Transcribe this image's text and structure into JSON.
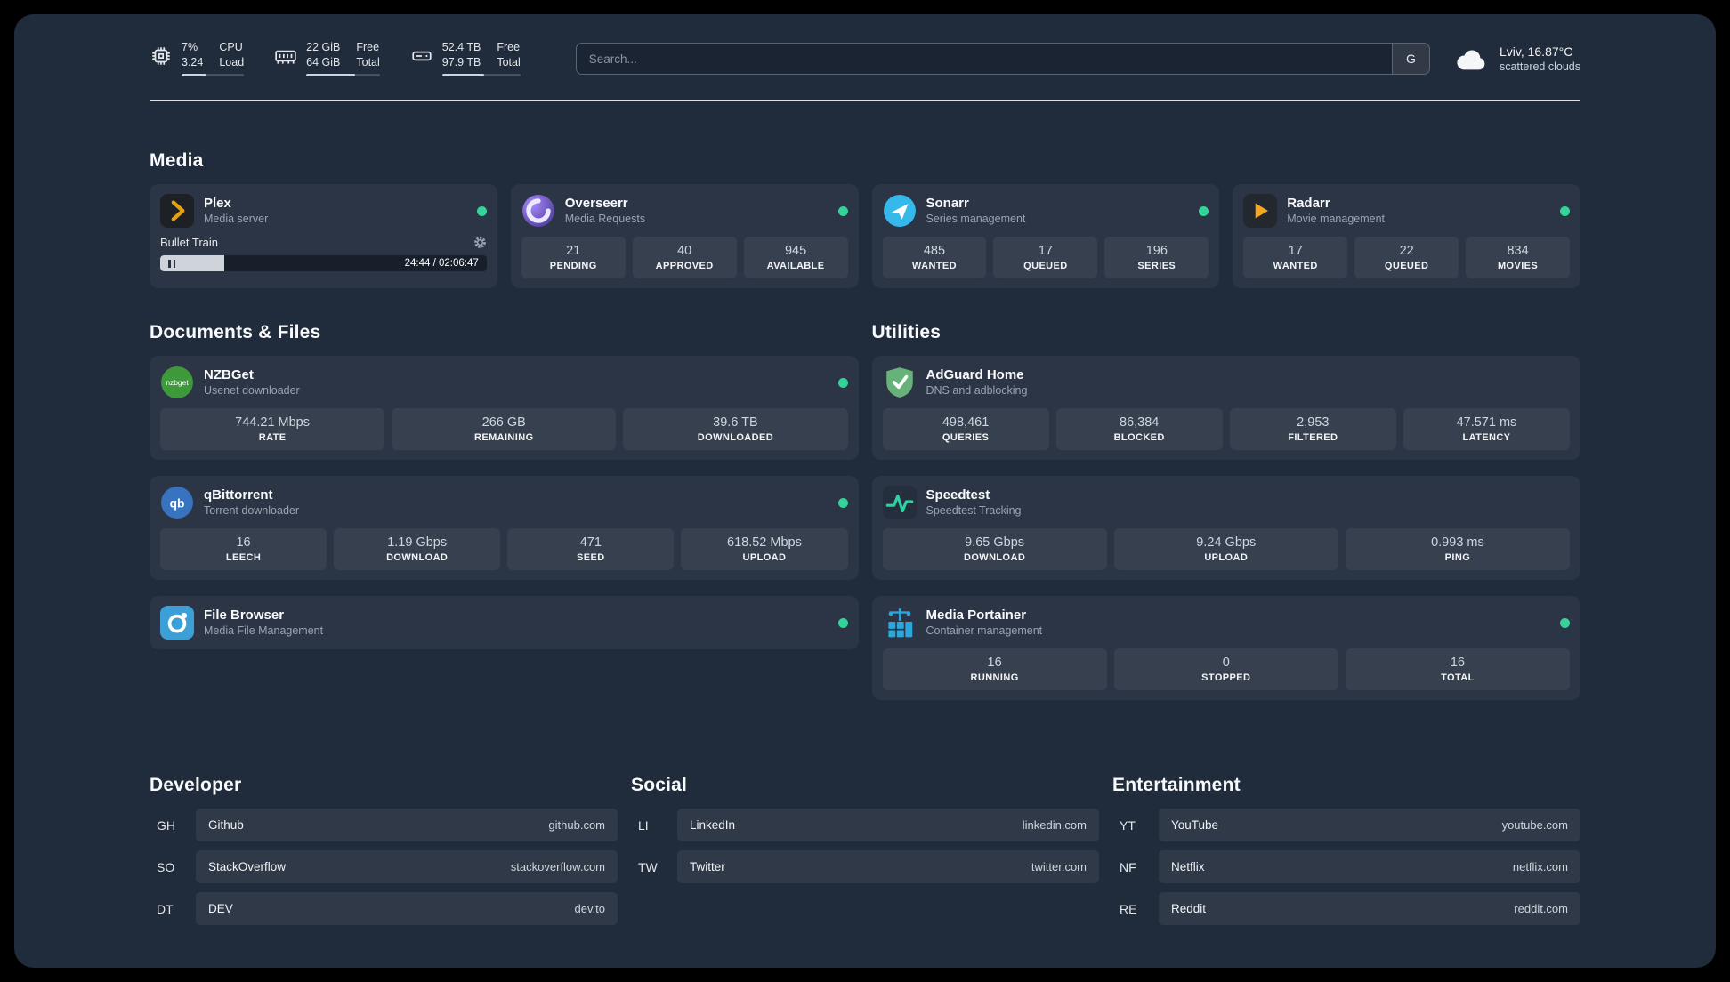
{
  "colors": {
    "background": "#202b3b",
    "online_dot": "#34d399",
    "plex_amber": "#e5a00d",
    "accent_blue": "#29a8e0"
  },
  "topbar": {
    "cpu": {
      "value_top": "7%",
      "value_bottom": "3.24",
      "label_top": "CPU",
      "label_bottom": "Load",
      "bar_pct": 40
    },
    "memory": {
      "value_top": "22 GiB",
      "value_bottom": "64 GiB",
      "label_top": "Free",
      "label_bottom": "Total",
      "bar_pct": 66
    },
    "disk": {
      "value_top": "52.4 TB",
      "value_bottom": "97.9 TB",
      "label_top": "Free",
      "label_bottom": "Total",
      "bar_pct": 54
    },
    "search": {
      "placeholder": "Search...",
      "button": "G"
    },
    "weather": {
      "location": "Lviv, 16.87°C",
      "condition": "scattered clouds"
    }
  },
  "media": {
    "heading": "Media",
    "cards": [
      {
        "title": "Plex",
        "subtitle": "Media server",
        "online": true,
        "player": {
          "track": "Bullet Train",
          "time": "24:44 / 02:06:47",
          "progress_pct": 19.5
        }
      },
      {
        "title": "Overseerr",
        "subtitle": "Media Requests",
        "online": true,
        "stats": [
          {
            "value": "21",
            "label": "PENDING"
          },
          {
            "value": "40",
            "label": "APPROVED"
          },
          {
            "value": "945",
            "label": "AVAILABLE"
          }
        ]
      },
      {
        "title": "Sonarr",
        "subtitle": "Series management",
        "online": true,
        "stats": [
          {
            "value": "485",
            "label": "WANTED"
          },
          {
            "value": "17",
            "label": "QUEUED"
          },
          {
            "value": "196",
            "label": "SERIES"
          }
        ]
      },
      {
        "title": "Radarr",
        "subtitle": "Movie management",
        "online": true,
        "stats": [
          {
            "value": "17",
            "label": "WANTED"
          },
          {
            "value": "22",
            "label": "QUEUED"
          },
          {
            "value": "834",
            "label": "MOVIES"
          }
        ]
      }
    ]
  },
  "documents": {
    "heading": "Documents & Files",
    "cards": [
      {
        "title": "NZBGet",
        "subtitle": "Usenet downloader",
        "online": true,
        "icon_text": "nzbget",
        "stats": [
          {
            "value": "744.21 Mbps",
            "label": "RATE"
          },
          {
            "value": "266 GB",
            "label": "REMAINING"
          },
          {
            "value": "39.6 TB",
            "label": "DOWNLOADED"
          }
        ]
      },
      {
        "title": "qBittorrent",
        "subtitle": "Torrent downloader",
        "online": true,
        "icon_text": "qb",
        "stats": [
          {
            "value": "16",
            "label": "LEECH"
          },
          {
            "value": "1.19 Gbps",
            "label": "DOWNLOAD"
          },
          {
            "value": "471",
            "label": "SEED"
          },
          {
            "value": "618.52 Mbps",
            "label": "UPLOAD"
          }
        ]
      },
      {
        "title": "File Browser",
        "subtitle": "Media File Management",
        "online": true
      }
    ]
  },
  "utilities": {
    "heading": "Utilities",
    "cards": [
      {
        "title": "AdGuard Home",
        "subtitle": "DNS and adblocking",
        "online": false,
        "stats": [
          {
            "value": "498,461",
            "label": "QUERIES"
          },
          {
            "value": "86,384",
            "label": "BLOCKED"
          },
          {
            "value": "2,953",
            "label": "FILTERED"
          },
          {
            "value": "47.571 ms",
            "label": "LATENCY"
          }
        ]
      },
      {
        "title": "Speedtest",
        "subtitle": "Speedtest Tracking",
        "online": false,
        "stats": [
          {
            "value": "9.65 Gbps",
            "label": "DOWNLOAD"
          },
          {
            "value": "9.24 Gbps",
            "label": "UPLOAD"
          },
          {
            "value": "0.993 ms",
            "label": "PING"
          }
        ]
      },
      {
        "title": "Media Portainer",
        "subtitle": "Container management",
        "online": true,
        "stats": [
          {
            "value": "16",
            "label": "RUNNING"
          },
          {
            "value": "0",
            "label": "STOPPED"
          },
          {
            "value": "16",
            "label": "TOTAL"
          }
        ]
      }
    ]
  },
  "bookmarks": [
    {
      "heading": "Developer",
      "items": [
        {
          "abbr": "GH",
          "name": "Github",
          "url": "github.com"
        },
        {
          "abbr": "SO",
          "name": "StackOverflow",
          "url": "stackoverflow.com"
        },
        {
          "abbr": "DT",
          "name": "DEV",
          "url": "dev.to"
        }
      ]
    },
    {
      "heading": "Social",
      "items": [
        {
          "abbr": "LI",
          "name": "LinkedIn",
          "url": "linkedin.com"
        },
        {
          "abbr": "TW",
          "name": "Twitter",
          "url": "twitter.com"
        }
      ]
    },
    {
      "heading": "Entertainment",
      "items": [
        {
          "abbr": "YT",
          "name": "YouTube",
          "url": "youtube.com"
        },
        {
          "abbr": "NF",
          "name": "Netflix",
          "url": "netflix.com"
        },
        {
          "abbr": "RE",
          "name": "Reddit",
          "url": "reddit.com"
        }
      ]
    }
  ]
}
